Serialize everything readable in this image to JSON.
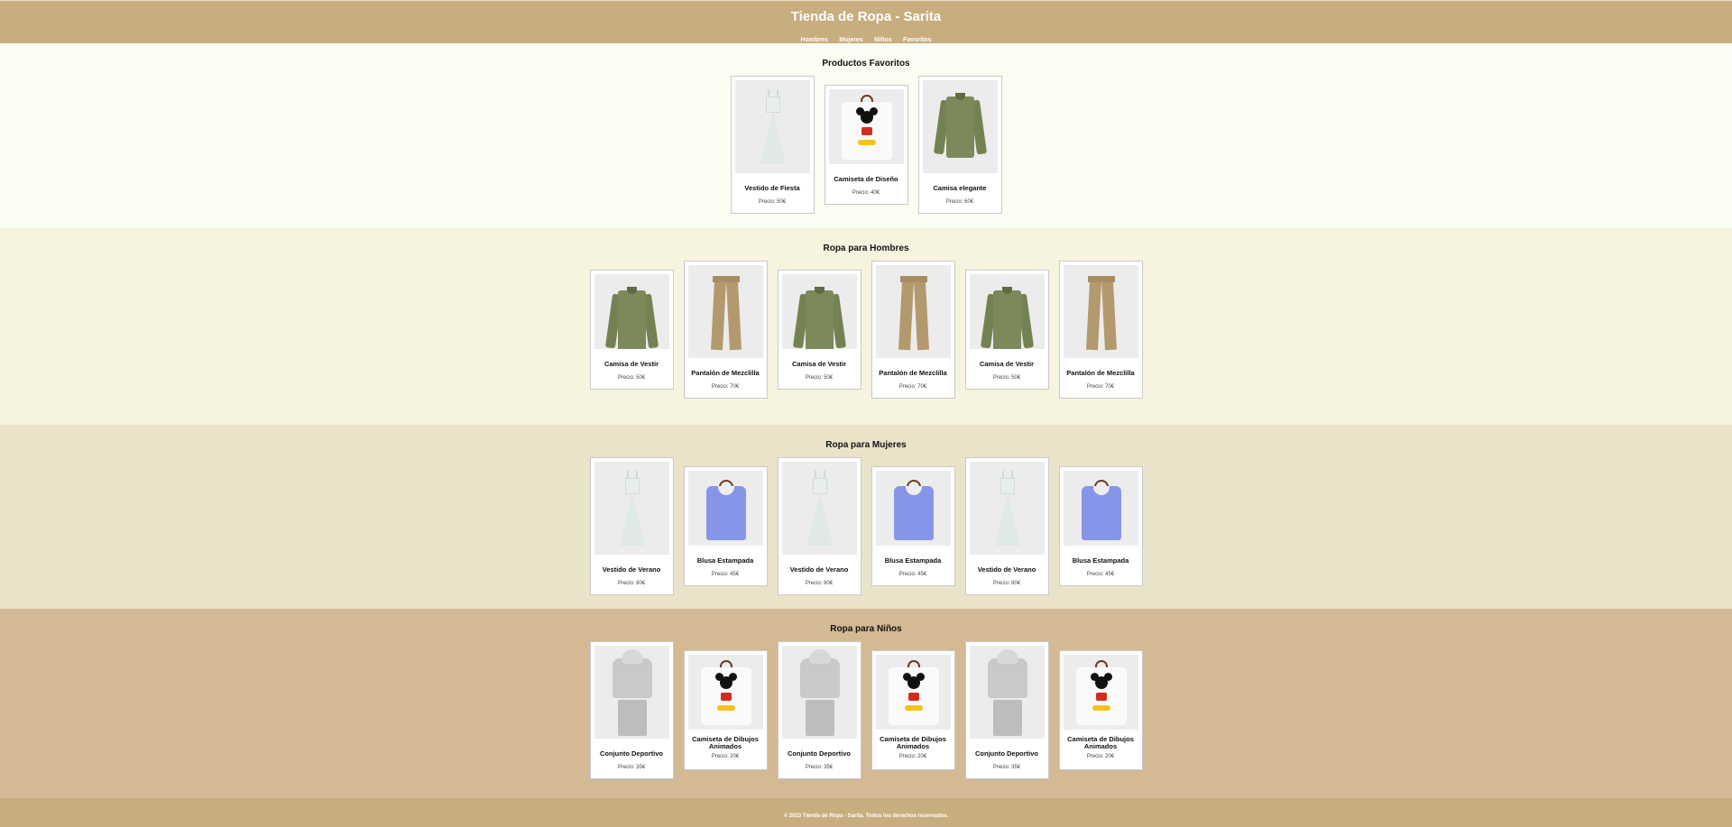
{
  "header": {
    "title": "Tienda de Ropa - Sarita",
    "nav": [
      "Hombres",
      "Mujeres",
      "Niños",
      "Favoritos"
    ]
  },
  "favoritos": {
    "title": "Productos Favoritos",
    "items": [
      {
        "name": "Vestido de Fiesta",
        "price": "Precio: 50€",
        "image": "dress-image"
      },
      {
        "name": "Camiseta de Diseño",
        "price": "Precio: 40€",
        "image": "mickey-tshirt-image"
      },
      {
        "name": "Camisa elegante",
        "price": "Precio: 60€",
        "image": "shirt-image"
      }
    ]
  },
  "hombres": {
    "title": "Ropa para Hombres",
    "items": [
      {
        "name": "Camisa de Vestir",
        "price": "Precio: 50€",
        "image": "shirt-image"
      },
      {
        "name": "Pantalón de Mezclilla",
        "price": "Precio: 70€",
        "image": "pants-image"
      },
      {
        "name": "Camisa de Vestir",
        "price": "Precio: 50€",
        "image": "shirt-image"
      },
      {
        "name": "Pantalón de Mezclilla",
        "price": "Precio: 70€",
        "image": "pants-image"
      },
      {
        "name": "Camisa de Vestir",
        "price": "Precio: 50€",
        "image": "shirt-image"
      },
      {
        "name": "Pantalón de Mezclilla",
        "price": "Precio: 70€",
        "image": "pants-image"
      }
    ]
  },
  "mujeres": {
    "title": "Ropa para Mujeres",
    "items": [
      {
        "name": "Vestido de Verano",
        "price": "Precio: 80€",
        "image": "dress-image"
      },
      {
        "name": "Blusa Estampada",
        "price": "Precio: 45€",
        "image": "blouse-image"
      },
      {
        "name": "Vestido de Verano",
        "price": "Precio: 80€",
        "image": "dress-image"
      },
      {
        "name": "Blusa Estampada",
        "price": "Precio: 45€",
        "image": "blouse-image"
      },
      {
        "name": "Vestido de Verano",
        "price": "Precio: 80€",
        "image": "dress-image"
      },
      {
        "name": "Blusa Estampada",
        "price": "Precio: 45€",
        "image": "blouse-image"
      }
    ]
  },
  "ninos": {
    "title": "Ropa para Niños",
    "items": [
      {
        "name": "Conjunto Deportivo",
        "price": "Precio: 35€",
        "image": "tracksuit-image"
      },
      {
        "name": "Camiseta de Dibujos Animados",
        "price": "Precio: 20€",
        "image": "mickey-tshirt-image"
      },
      {
        "name": "Conjunto Deportivo",
        "price": "Precio: 35€",
        "image": "tracksuit-image"
      },
      {
        "name": "Camiseta de Dibujos Animados",
        "price": "Precio: 20€",
        "image": "mickey-tshirt-image"
      },
      {
        "name": "Conjunto Deportivo",
        "price": "Precio: 35€",
        "image": "tracksuit-image"
      },
      {
        "name": "Camiseta de Dibujos Animados",
        "price": "Precio: 20€",
        "image": "mickey-tshirt-image"
      }
    ]
  },
  "footer": {
    "text": "© 2023 Tienda de Ropa - Sarita. Todos los derechos reservados."
  },
  "colors": {
    "header_bg": "#c8ad7f",
    "favoritos_bg": "#f9fdf2",
    "hombres_bg": "#f6f4de",
    "mujeres_bg": "#ebe2ca",
    "ninos_bg": "#d3b994"
  }
}
